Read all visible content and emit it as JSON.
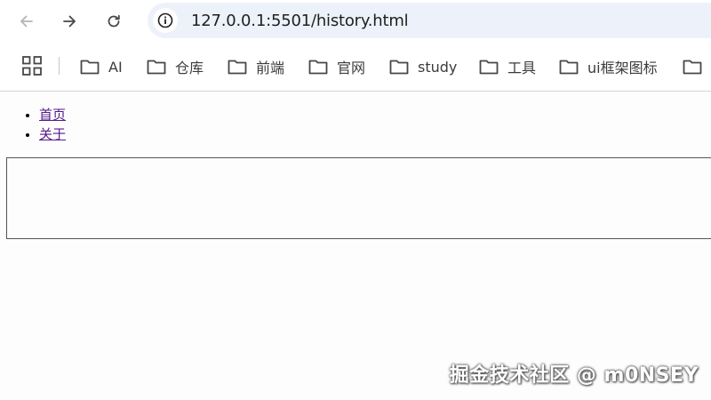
{
  "browser": {
    "url": "127.0.0.1:5501/history.html",
    "bookmarks": [
      {
        "label": "AI"
      },
      {
        "label": "仓库"
      },
      {
        "label": "前端"
      },
      {
        "label": "官网"
      },
      {
        "label": "study"
      },
      {
        "label": "工具"
      },
      {
        "label": "ui框架图标"
      },
      {
        "label": ""
      }
    ]
  },
  "page": {
    "nav_links": [
      {
        "label": "首页"
      },
      {
        "label": "关于"
      }
    ]
  },
  "watermark": "掘金技术社区 @ m0NSEY",
  "colors": {
    "omnibox_bg": "#edf2fa",
    "visited_link": "#551a8b",
    "icon": "#474747"
  },
  "icons": {
    "back": "arrow-left-icon",
    "forward": "arrow-right-icon",
    "reload": "reload-icon",
    "site_info": "info-icon",
    "apps": "grid-icon",
    "bookmark": "folder-icon"
  }
}
